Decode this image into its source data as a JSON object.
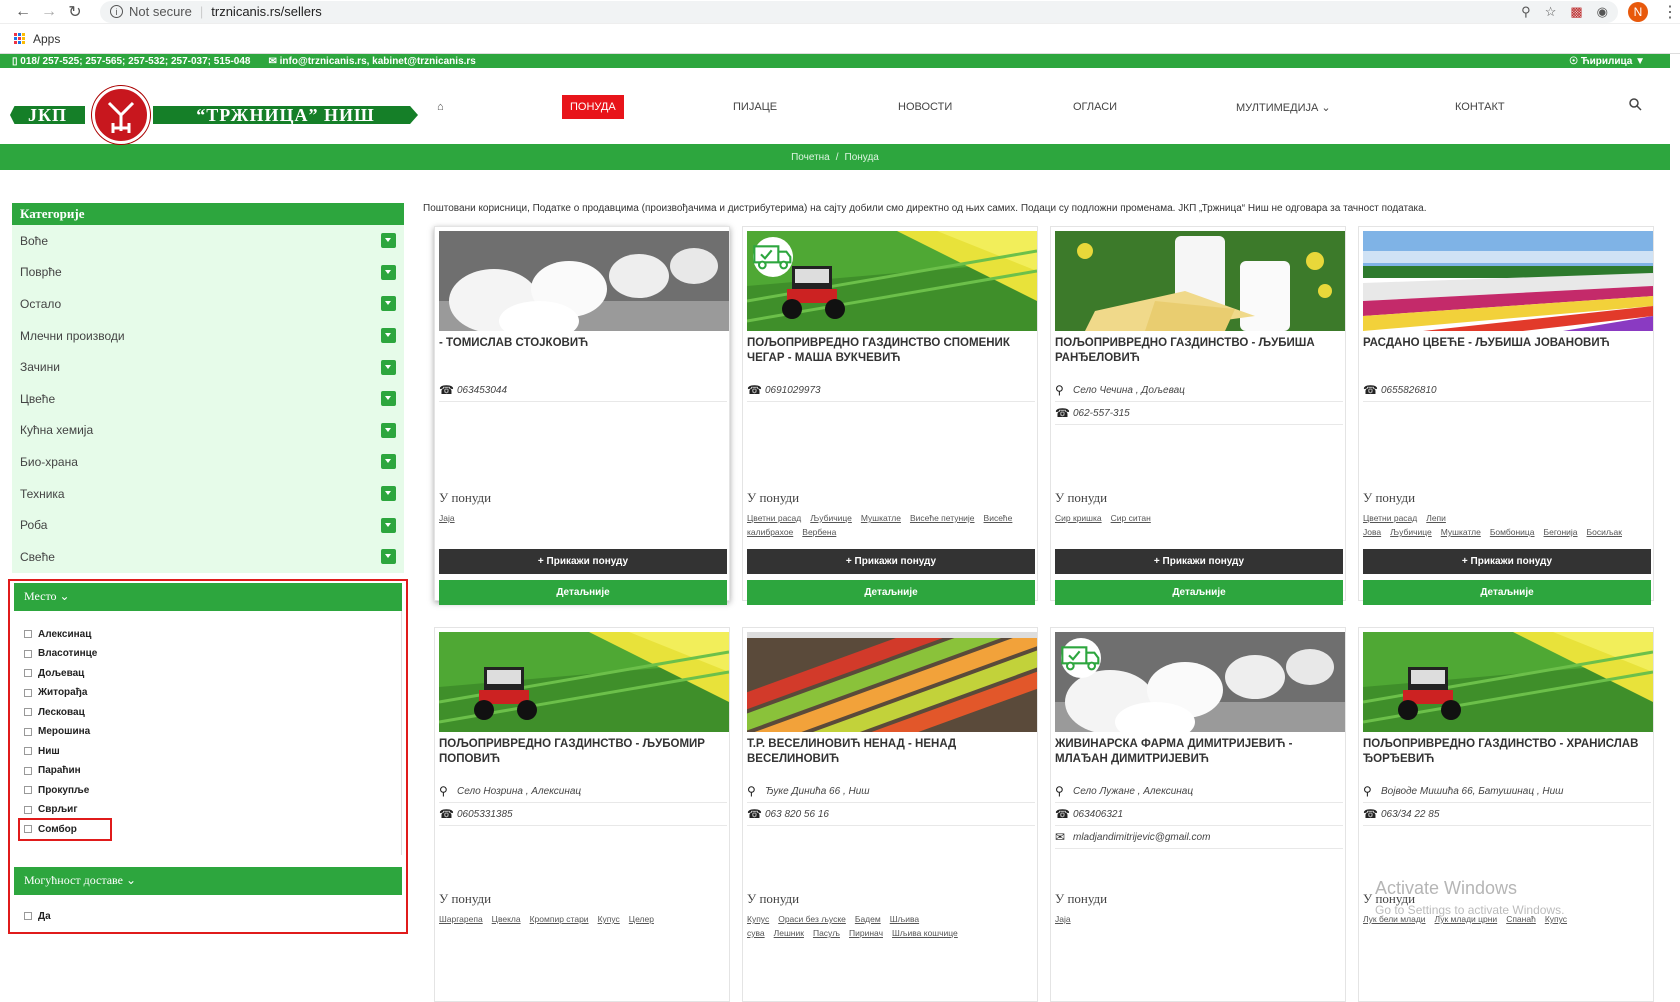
{
  "browser": {
    "security": "Not secure",
    "url": "trznicanis.rs/sellers",
    "profile_initial": "N",
    "bookmark_apps": "Apps"
  },
  "topbar": {
    "phones": "018/ 257-525; 257-565; 257-532; 257-037; 515-048",
    "emails": "info@trznicanis.rs, kabinet@trznicanis.rs",
    "language": "Ћирилица ▼"
  },
  "logo": {
    "left_text": "ЈКП",
    "right_text": "“ТРЖНИЦА” НИШ"
  },
  "nav": {
    "home": "⌂",
    "items": [
      "ПОНУДА",
      "ПИЈАЦЕ",
      "НОВОСТИ",
      "ОГЛАСИ",
      "МУЛТИМЕДИЈА ⌄",
      "КОНТАКТ"
    ]
  },
  "breadcrumb": {
    "home": "Почетна",
    "sep": "/",
    "current": "Понуда"
  },
  "sidebar": {
    "categories_title": "Категорије",
    "categories": [
      "Воће",
      "Поврће",
      "Остало",
      "Млечни производи",
      "Зачини",
      "Цвеће",
      "Кућна хемија",
      "Био-храна",
      "Техника",
      "Роба",
      "Свеће"
    ],
    "place_title": "Место ⌄",
    "places": [
      "Алексинац",
      "Власотинце",
      "Дољевац",
      "Житорађа",
      "Лесковац",
      "Мерошина",
      "Ниш",
      "Параћин",
      "Прокупље",
      "Сврљиг",
      "Сомбор"
    ],
    "delivery_title": "Могућност доставе ⌄",
    "delivery_options": [
      "Да"
    ]
  },
  "notice": "Поштовани корисници, Податке о продавцима (произвођачима и дистрибутерима) на сајту добили смо директно од њих самих. Подаци су подложни променама. ЈКП „Тржница“ Ниш не одговара за тачност података.",
  "labels": {
    "offer": "У понуди",
    "show_offer": "+ Прикажи понуду",
    "details": "Детаљније"
  },
  "sellers": [
    {
      "title": "- ТОМИСЛАВ СТОЈКОВИЋ",
      "address": "",
      "phone": "063453044",
      "email": "",
      "tags": [
        "Јаја"
      ],
      "image": "eggs",
      "delivery": false
    },
    {
      "title": "ПОЉОПРИВРЕДНО ГАЗДИНСТВО СПОМЕНИК ЧЕГАР - МАША ВУКЧЕВИЋ",
      "address": "",
      "phone": "0691029973",
      "email": "",
      "tags": [
        "Цветни расад",
        "Љубичице",
        "Мушкатле",
        "Висеће петуније",
        "Висеће калибрахое",
        "Вербена"
      ],
      "image": "tractor",
      "delivery": true
    },
    {
      "title": "ПОЉОПРИВРЕДНО ГАЗДИНСТВО - ЉУБИША РАНЂЕЛОВИЋ",
      "address": "Село Чечина , Дољевац",
      "phone": "062-557-315",
      "email": "",
      "tags": [
        "Сир кришка",
        "Сир ситан"
      ],
      "image": "milk",
      "delivery": false
    },
    {
      "title": "РАСДАНО ЦВЕЋЕ - ЉУБИША ЈОВАНОВИЋ",
      "address": "",
      "phone": "0655826810",
      "email": "",
      "tags": [
        "Цветни расад",
        "Лепи Јова",
        "Љубичице",
        "Мушкатле",
        "Бомбоница",
        "Бегонија",
        "Босиљак"
      ],
      "image": "flowers",
      "delivery": false
    },
    {
      "title": "ПОЉОПРИВРЕДНО ГАЗДИНСТВО - ЉУБОМИР ПОПОВИЋ",
      "address": "Село Нозрина , Алексинац",
      "phone": "0605331385",
      "email": "",
      "tags": [
        "Шаргарепа",
        "Цвекла",
        "Кромпир стари",
        "Купус",
        "Целер"
      ],
      "image": "tractor",
      "delivery": false
    },
    {
      "title": "Т.Р. ВЕСЕЛИНОВИЋ НЕНАД - НЕНАД ВЕСЕЛИНОВИЋ",
      "address": "Ђуке Динића 66 , Ниш",
      "phone": "063 820 56 16",
      "email": "",
      "tags": [
        "Купус",
        "Ораси без љуске",
        "Бадем",
        "Шљива сува",
        "Лешник",
        "Пасуљ",
        "Пиринач",
        "Шљива кошчице"
      ],
      "image": "market",
      "delivery": false
    },
    {
      "title": "ЖИВИНАРСКА ФАРМА ДИМИТРИЈЕВИЋ - МЛАЂАН ДИМИТРИЈЕВИЋ",
      "address": "Село Лужане , Алексинац",
      "phone": "063406321",
      "email": "mladjandimitrijevic@gmail.com",
      "tags": [
        "Јаја"
      ],
      "image": "eggs",
      "delivery": true
    },
    {
      "title": "ПОЉОПРИВРЕДНО ГАЗДИНСТВО - ХРАНИСЛАВ ЂОРЂЕВИЋ",
      "address": "Војводе Мишића 66, Батушинац , Ниш",
      "phone": "063/34 22 85",
      "email": "",
      "tags": [
        "Лук бели млади",
        "Лук млади црни",
        "Спанаћ",
        "Купус"
      ],
      "image": "tractor",
      "delivery": false
    }
  ],
  "watermark": {
    "line1": "Activate Windows",
    "line2": "Go to Settings to activate Windows."
  },
  "colors": {
    "green": "#2da63e",
    "red": "#e8141a",
    "dark": "#333333"
  }
}
